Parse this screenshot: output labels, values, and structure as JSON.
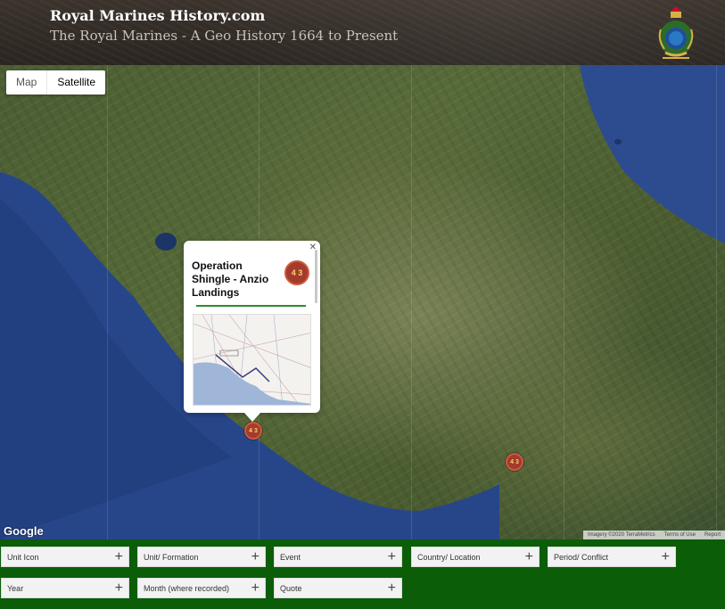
{
  "header": {
    "title": "Royal Marines History.com",
    "subtitle": "The Royal Marines - A Geo History 1664 to Present",
    "crest_icon": "royal-marines-crest-icon"
  },
  "map": {
    "type_controls": [
      "Map",
      "Satellite"
    ],
    "active_type": "Satellite",
    "google_logo": "Google",
    "attribution": [
      "Imagery ©2020 TerraMetrics",
      "Terms of Use",
      "Report"
    ],
    "marker_text": "4 3",
    "info_window": {
      "title": "Operation Shingle - Anzio Landings",
      "close_label": "✕",
      "icon_text": "4 3",
      "accent_color": "#2e8b2e"
    }
  },
  "filters": {
    "row1": [
      "Unit Icon",
      "Unit/ Formation",
      "Event",
      "Country/ Location",
      "Period/ Conflict"
    ],
    "row2": [
      "Year",
      "Month (where recorded)",
      "Quote"
    ],
    "plus": "+"
  },
  "colors": {
    "filter_bar": "#0b5d08",
    "marker": "#a33b2e",
    "header": "#2a2520"
  }
}
